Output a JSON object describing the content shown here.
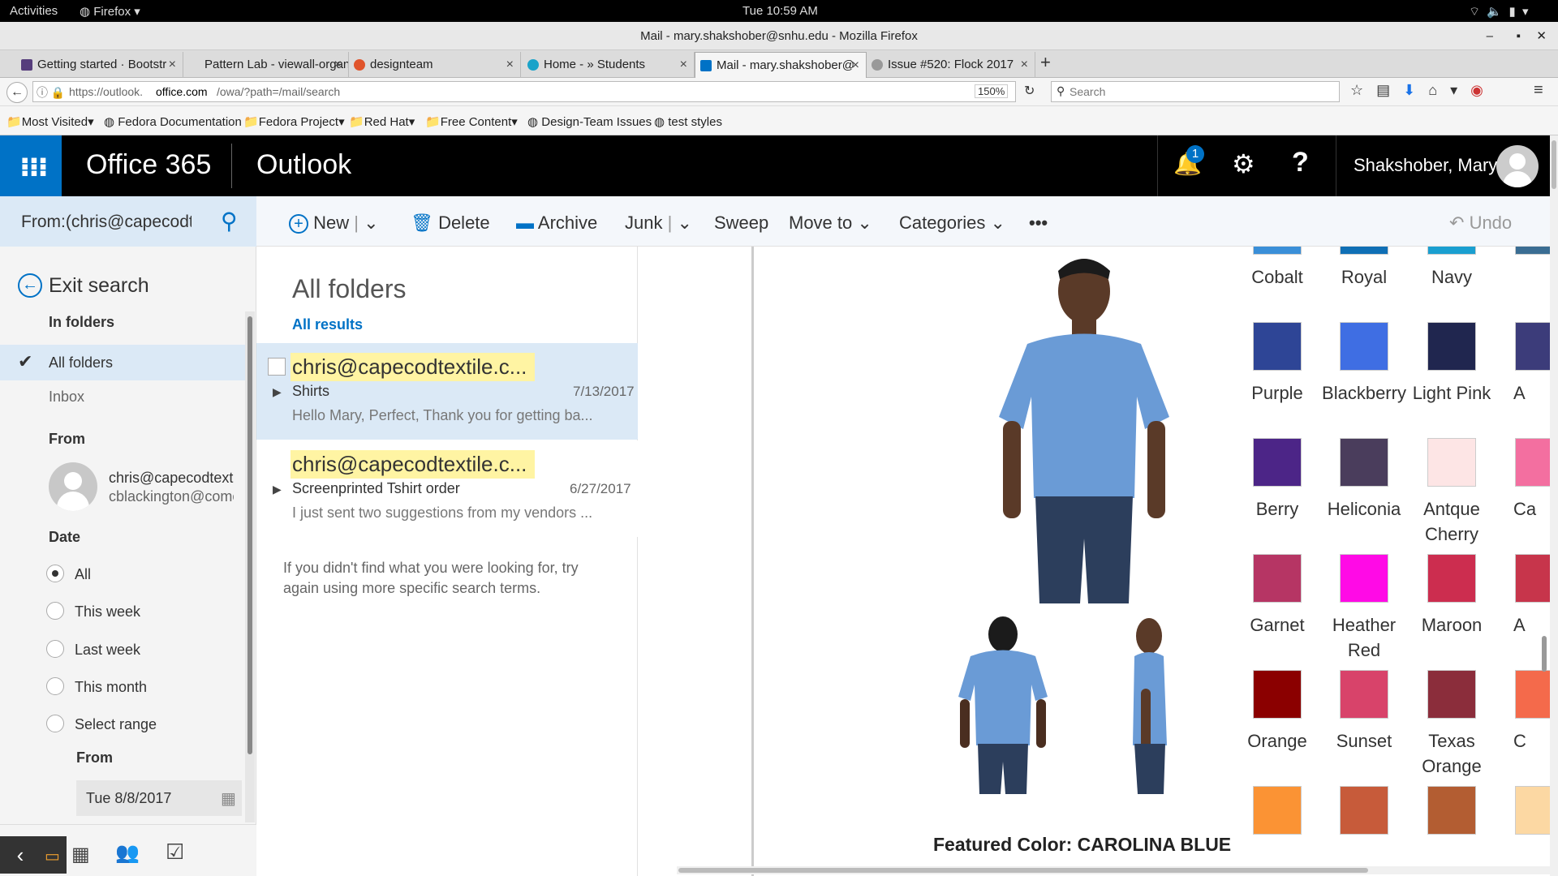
{
  "os_bar": {
    "activities": "Activities",
    "app": "Firefox",
    "clock": "Tue 10:59 AM"
  },
  "window_title": "Mail - mary.shakshober@snhu.edu - Mozilla Firefox",
  "tabs": [
    {
      "label": "Getting started · Bootstr",
      "color": "#563d7c"
    },
    {
      "label": "Pattern Lab - viewall-organi",
      "color": "#ffffff"
    },
    {
      "label": "designteam",
      "color": "#e0542b"
    },
    {
      "label": "Home - » Students",
      "color": "#1aa3c9"
    },
    {
      "label": "Mail - mary.shakshober@",
      "color": "#0072c6"
    },
    {
      "label": "Issue #520: Flock 2017",
      "color": "#999999"
    }
  ],
  "nav": {
    "url_prefix": "https://outlook.",
    "url_domain": "office.com",
    "url_suffix": "/owa/?path=/mail/search",
    "zoom": "150%",
    "search_placeholder": "Search"
  },
  "bookmarks": [
    "Most Visited",
    "Fedora Documentation",
    "Fedora Project",
    "Red Hat",
    "Free Content",
    "Design-Team Issues",
    "test styles"
  ],
  "header": {
    "brand": "Office 365",
    "app": "Outlook",
    "notifications": "1",
    "user": "Shakshober, Mary"
  },
  "search_box": {
    "value": "From:(chris@capecodte"
  },
  "commands": {
    "new": "New",
    "delete": "Delete",
    "archive": "Archive",
    "junk": "Junk",
    "sweep": "Sweep",
    "move": "Move to",
    "categories": "Categories",
    "more": "•••",
    "undo": "Undo"
  },
  "left": {
    "exit": "Exit search",
    "in_folders": "In folders",
    "all_folders": "All folders",
    "inbox": "Inbox",
    "from": "From",
    "from_name": "chris@capecodtextil",
    "from_email": "cblackington@comc",
    "date": "Date",
    "date_options": [
      "All",
      "This week",
      "Last week",
      "This month",
      "Select range"
    ],
    "from_label": "From",
    "from_date": "Tue 8/8/2017"
  },
  "list": {
    "title": "All folders",
    "subtitle": "All results",
    "messages": [
      {
        "sender": "chris@capecodtextile.c...",
        "subject": "Shirts",
        "date": "7/13/2017",
        "preview": "Hello Mary, Perfect, Thank you for getting ba..."
      },
      {
        "sender": "chris@capecodtextile.c...",
        "subject": "Screenprinted Tshirt order",
        "date": "6/27/2017",
        "preview": "I just sent two suggestions from my vendors ..."
      }
    ],
    "hint": "If you didn't find what you were looking for, try again using more specific search terms."
  },
  "reading": {
    "featured": "Featured Color: CAROLINA BLUE",
    "rows": [
      {
        "labels": [
          "Cobalt",
          "Royal",
          "Navy",
          ""
        ],
        "colors": [
          "#3a8fd8",
          "#0f6fb5",
          "#1a9fd0",
          "#3a6d93"
        ]
      },
      {
        "labels": [
          "Purple",
          "Blackberry",
          "Light Pink",
          "A"
        ],
        "colors": [
          "#2e4596",
          "#3f6ee3",
          "#20264f",
          "#3c3c7a"
        ]
      },
      {
        "labels": [
          "Berry",
          "Heliconia",
          "Antque Cherry",
          "Ca"
        ],
        "colors": [
          "#4c2587",
          "#4a3d5c",
          "#fde5e5",
          "#f36fa0"
        ]
      },
      {
        "labels": [
          "Garnet",
          "Heather Red",
          "Maroon",
          "A"
        ],
        "colors": [
          "#b63564",
          "#ff0ae6",
          "#cc2d4f",
          "#c7354b"
        ]
      },
      {
        "labels": [
          "Orange",
          "Sunset",
          "Texas Orange",
          "C"
        ],
        "colors": [
          "#8b0000",
          "#d8436a",
          "#8b2d3b",
          "#f46a4b"
        ]
      },
      {
        "labels": [
          "",
          "",
          "",
          ""
        ],
        "colors": [
          "#fb9334",
          "#c75b3a",
          "#b35d32",
          "#fcd8a3"
        ]
      }
    ]
  }
}
